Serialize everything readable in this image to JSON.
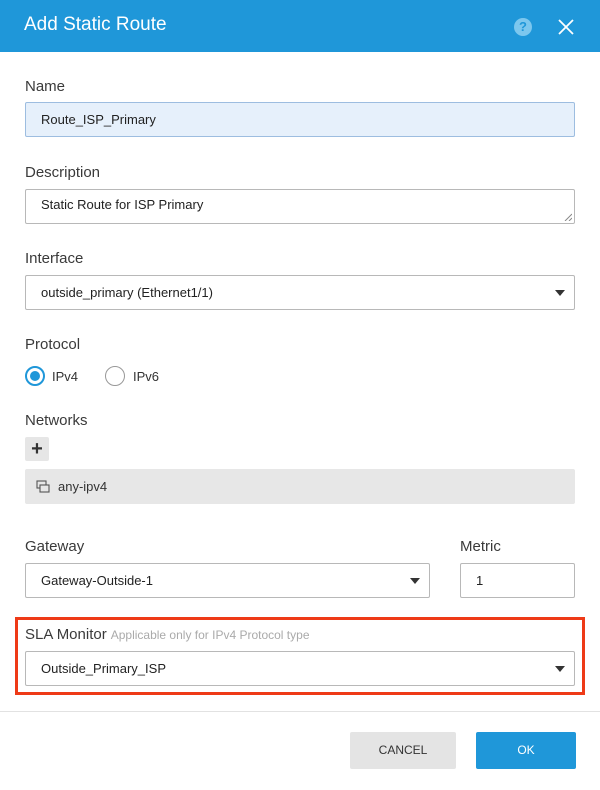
{
  "dialog": {
    "title": "Add Static Route",
    "help_icon": "question-circle-icon",
    "close_icon": "close-icon"
  },
  "form": {
    "name": {
      "label": "Name",
      "value": "Route_ISP_Primary"
    },
    "description": {
      "label": "Description",
      "value": "Static Route for ISP Primary"
    },
    "interface": {
      "label": "Interface",
      "value": "outside_primary (Ethernet1/1)"
    },
    "protocol": {
      "label": "Protocol",
      "options": [
        {
          "label": "IPv4",
          "selected": true
        },
        {
          "label": "IPv6",
          "selected": false
        }
      ]
    },
    "networks": {
      "label": "Networks",
      "add_icon": "plus-icon",
      "items": [
        {
          "icon": "network-object-icon",
          "label": "any-ipv4"
        }
      ]
    },
    "gateway": {
      "label": "Gateway",
      "value": "Gateway-Outside-1"
    },
    "metric": {
      "label": "Metric",
      "value": "1"
    },
    "sla_monitor": {
      "label": "SLA Monitor",
      "note": "Applicable only for IPv4 Protocol type",
      "value": "Outside_Primary_ISP",
      "highlight_color": "#ee3a17"
    }
  },
  "footer": {
    "cancel_label": "CANCEL",
    "ok_label": "OK"
  },
  "colors": {
    "accent": "#1f97d9",
    "highlight": "#ee3a17"
  }
}
